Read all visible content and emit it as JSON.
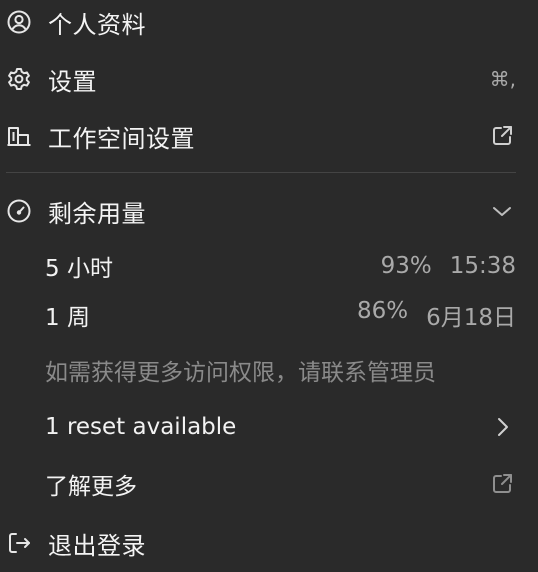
{
  "menu": {
    "profile": {
      "label": "个人资料",
      "icon": "user-circle-icon"
    },
    "settings": {
      "label": "设置",
      "shortcut": "⌘,",
      "icon": "gear-icon"
    },
    "workspace_settings": {
      "label": "工作空间设置",
      "icon": "building-icon",
      "trailing_icon": "external-link-icon"
    },
    "usage": {
      "label": "剩余用量",
      "icon": "gauge-icon",
      "trailing_icon": "chevron-down-icon",
      "rows": [
        {
          "period": "5 小时",
          "percent": "93%",
          "reset": "15:38"
        },
        {
          "period": "1 周",
          "percent": "86%",
          "reset": "6月18日"
        }
      ],
      "hint": "如需获得更多访问权限，请联系管理员",
      "reset_available": {
        "label": "1 reset available",
        "trailing_icon": "chevron-right-icon"
      }
    },
    "learn_more": {
      "label": "了解更多",
      "trailing_icon": "external-link-icon"
    },
    "logout": {
      "label": "退出登录",
      "icon": "logout-icon"
    }
  },
  "colors": {
    "background": "#2a2a2a",
    "text": "#f4f4f4",
    "muted": "#a9a9a9",
    "hint": "#8a8a8a",
    "divider": "#444444"
  }
}
